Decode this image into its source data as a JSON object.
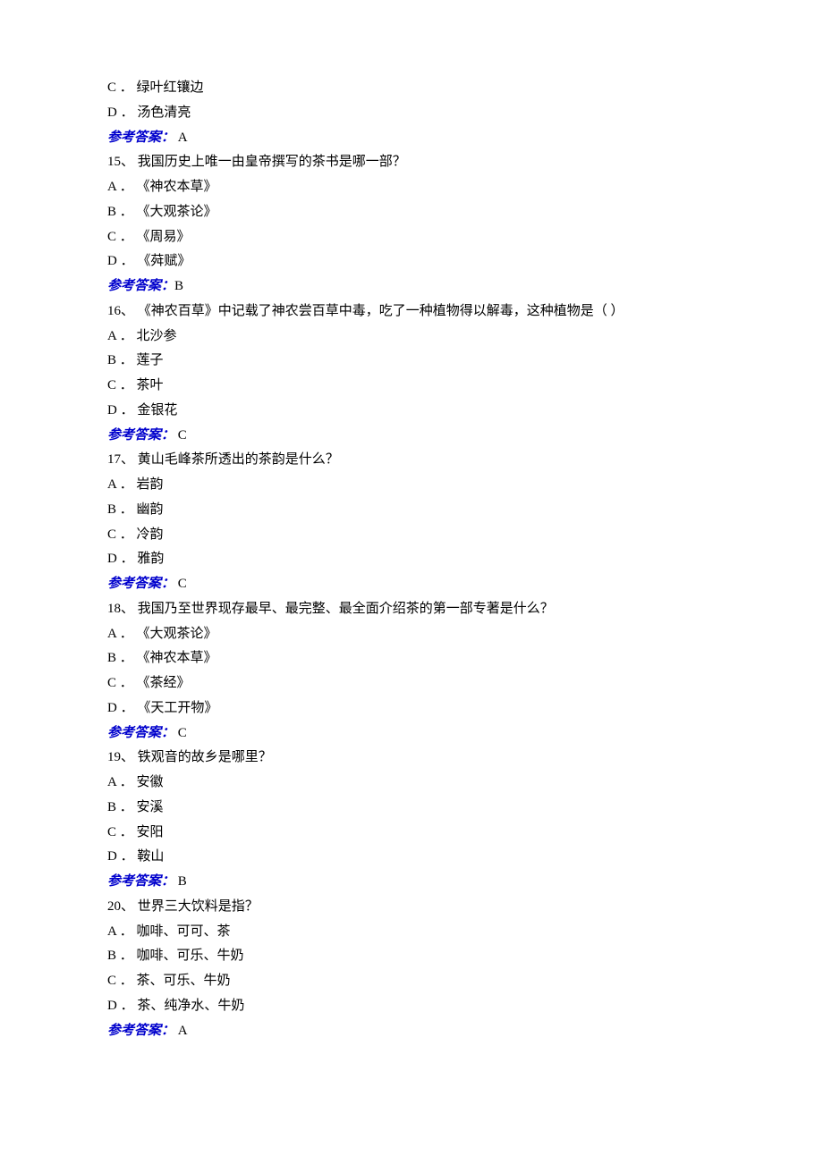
{
  "leading_options": [
    {
      "letter": "C",
      "text": "绿叶红镶边"
    },
    {
      "letter": "D",
      "text": "汤色清亮"
    }
  ],
  "leading_answer": {
    "label": "参考答案：",
    "value": " A"
  },
  "questions": [
    {
      "num": "15、",
      "text": " 我国历史上唯一由皇帝撰写的茶书是哪一部？",
      "options": [
        {
          "letter": "A",
          "text": "《神农本草》"
        },
        {
          "letter": "B",
          "text": "《大观茶论》"
        },
        {
          "letter": "C",
          "text": "《周易》"
        },
        {
          "letter": "D",
          "text": "《荈赋》"
        }
      ],
      "answer": {
        "label": "参考答案：",
        "value": "B"
      }
    },
    {
      "num": "16、",
      "text": " 《神农百草》中记载了神农尝百草中毒，吃了一种植物得以解毒，这种植物是（ ）",
      "options": [
        {
          "letter": "A",
          "text": "北沙参"
        },
        {
          "letter": "B",
          "text": "莲子"
        },
        {
          "letter": "C",
          "text": "茶叶"
        },
        {
          "letter": "D",
          "text": "金银花"
        }
      ],
      "answer": {
        "label": "参考答案：",
        "value": " C"
      }
    },
    {
      "num": "17、",
      "text": " 黄山毛峰茶所透出的茶韵是什么？",
      "options": [
        {
          "letter": "A",
          "text": "岩韵"
        },
        {
          "letter": "B",
          "text": "幽韵"
        },
        {
          "letter": "C",
          "text": "冷韵"
        },
        {
          "letter": "D",
          "text": "雅韵"
        }
      ],
      "answer": {
        "label": "参考答案：",
        "value": " C"
      }
    },
    {
      "num": "18、",
      "text": " 我国乃至世界现存最早、最完整、最全面介绍茶的第一部专著是什么？",
      "options": [
        {
          "letter": "A",
          "text": "《大观茶论》"
        },
        {
          "letter": "B",
          "text": "《神农本草》"
        },
        {
          "letter": "C",
          "text": "《茶经》"
        },
        {
          "letter": "D",
          "text": "《天工开物》"
        }
      ],
      "answer": {
        "label": "参考答案：",
        "value": " C"
      }
    },
    {
      "num": "19、",
      "text": " 铁观音的故乡是哪里？",
      "options": [
        {
          "letter": "A",
          "text": "安徽"
        },
        {
          "letter": "B",
          "text": "安溪"
        },
        {
          "letter": "C",
          "text": "安阳"
        },
        {
          "letter": "D",
          "text": "鞍山"
        }
      ],
      "answer": {
        "label": "参考答案：",
        "value": " B"
      }
    },
    {
      "num": "20、",
      "text": " 世界三大饮料是指？",
      "options": [
        {
          "letter": "A",
          "text": "咖啡、可可、茶"
        },
        {
          "letter": "B",
          "text": "咖啡、可乐、牛奶"
        },
        {
          "letter": "C",
          "text": "茶、可乐、牛奶"
        },
        {
          "letter": "D",
          "text": "茶、纯净水、牛奶"
        }
      ],
      "answer": {
        "label": "参考答案：",
        "value": " A"
      }
    }
  ]
}
